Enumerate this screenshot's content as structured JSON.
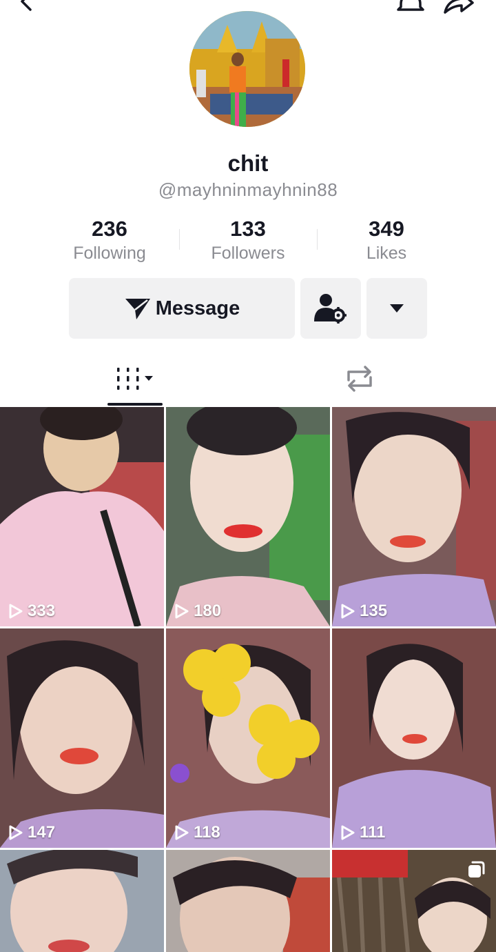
{
  "profile": {
    "display_name": "chit",
    "username": "@mayhninmayhnin88"
  },
  "stats": [
    {
      "value": "236",
      "label": "Following"
    },
    {
      "value": "133",
      "label": "Followers"
    },
    {
      "value": "349",
      "label": "Likes"
    }
  ],
  "actions": {
    "message_label": "Message",
    "message_icon": "send-icon",
    "settings_icon": "user-settings-icon",
    "more_icon": "caret-down-icon"
  },
  "tabs": [
    {
      "name": "videos",
      "icon": "grid-icon"
    },
    {
      "name": "reposts",
      "icon": "repost-icon"
    }
  ],
  "videos": [
    {
      "views": "333"
    },
    {
      "views": "180"
    },
    {
      "views": "135"
    },
    {
      "views": "147"
    },
    {
      "views": "118"
    },
    {
      "views": "111"
    },
    {
      "views": ""
    },
    {
      "views": ""
    },
    {
      "views": ""
    }
  ],
  "colors": {
    "text": "#161823",
    "secondary": "#8a8b91",
    "button_bg": "#f1f1f2"
  }
}
